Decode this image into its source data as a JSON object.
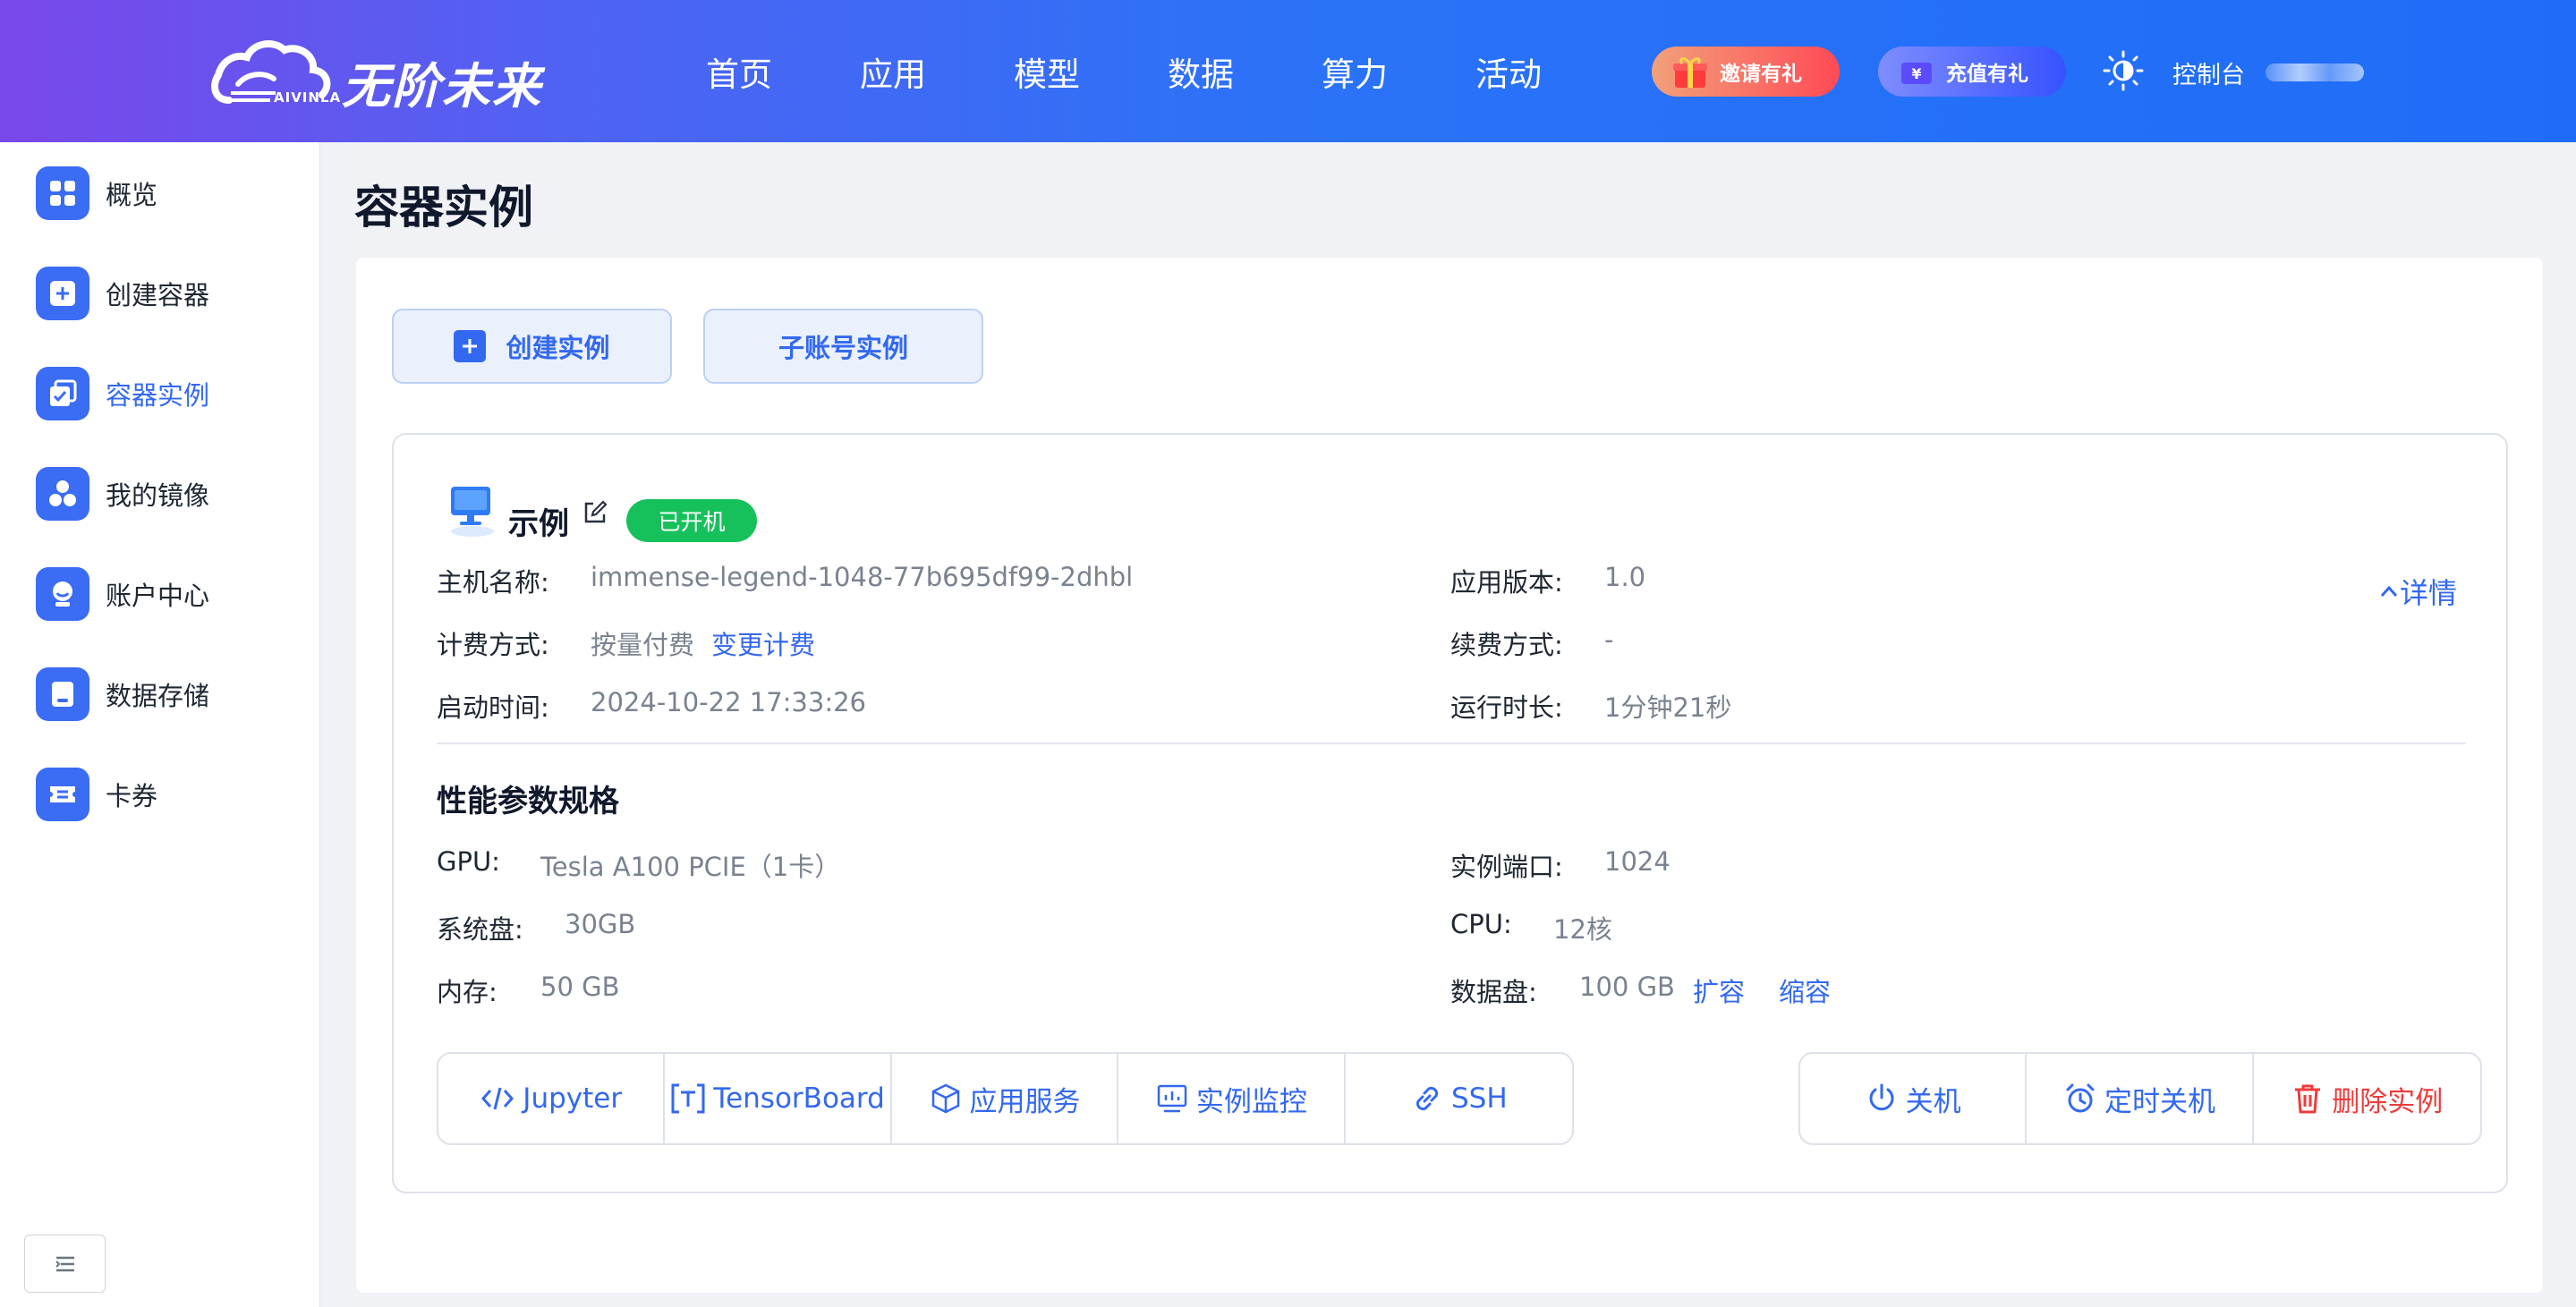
{
  "header": {
    "logo_sub": "AIVINLA",
    "logo_text": "无阶未来",
    "nav": [
      "首页",
      "应用",
      "模型",
      "数据",
      "算力",
      "活动"
    ],
    "invite_label": "邀请有礼",
    "recharge_label": "充值有礼",
    "console_label": "控制台"
  },
  "sidebar": {
    "items": [
      {
        "label": "概览",
        "icon": "grid-icon"
      },
      {
        "label": "创建容器",
        "icon": "plus-square-icon"
      },
      {
        "label": "容器实例",
        "icon": "container-icon"
      },
      {
        "label": "我的镜像",
        "icon": "cubes-icon"
      },
      {
        "label": "账户中心",
        "icon": "user-icon"
      },
      {
        "label": "数据存储",
        "icon": "storage-icon"
      },
      {
        "label": "卡券",
        "icon": "ticket-icon"
      }
    ],
    "active_index": 2
  },
  "page": {
    "title": "容器实例",
    "create_label": "创建实例",
    "sub_label": "子账号实例"
  },
  "instance": {
    "name": "示例",
    "status": "已开机",
    "detail_label": "详情",
    "hostname_label": "主机名称:",
    "hostname": "immense-legend-1048-77b695df99-2dhbl",
    "billing_label": "计费方式:",
    "billing": "按量付费",
    "change_billing": "变更计费",
    "start_label": "启动时间:",
    "start_time": "2024-10-22 17:33:26",
    "version_label": "应用版本:",
    "version": "1.0",
    "renew_label": "续费方式:",
    "renew": "-",
    "runtime_label": "运行时长:",
    "runtime": "1分钟21秒",
    "spec_title": "性能参数规格",
    "gpu_label": "GPU:",
    "gpu": "Tesla A100 PCIE（1卡）",
    "sysdisk_label": "系统盘:",
    "sysdisk": "30GB",
    "mem_label": "内存:",
    "mem": "50 GB",
    "port_label": "实例端口:",
    "port": "1024",
    "cpu_label": "CPU:",
    "cpu": "12核",
    "datadisk_label": "数据盘:",
    "datadisk": "100 GB",
    "expand": "扩容",
    "shrink": "缩容",
    "tools": [
      "Jupyter",
      "TensorBoard",
      "应用服务",
      "实例监控",
      "SSH"
    ],
    "shutdown": "关机",
    "timed_shutdown": "定时关机",
    "delete": "删除实例"
  },
  "colors": {
    "accent": "#3368f0",
    "running": "#16c15c",
    "danger": "#ee3b3b"
  }
}
